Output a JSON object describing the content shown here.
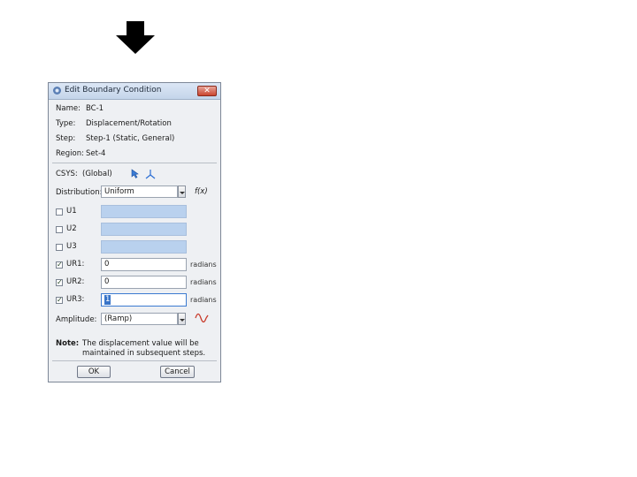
{
  "dialog": {
    "title": "Edit Boundary Condition",
    "close_glyph": "✕",
    "name_label": "Name:",
    "name_value": "BC-1",
    "type_label": "Type:",
    "type_value": "Displacement/Rotation",
    "step_label": "Step:",
    "step_value": "Step-1 (Static, General)",
    "region_label": "Region:",
    "region_value": "Set-4",
    "csys_label": "CSYS:",
    "csys_value": "(Global)",
    "distribution_label": "Distribution:",
    "distribution_value": "Uniform",
    "fx_label": "f(x)",
    "rows": [
      {
        "label": "U1",
        "checked": false,
        "value": "",
        "unit": ""
      },
      {
        "label": "U2",
        "checked": false,
        "value": "",
        "unit": ""
      },
      {
        "label": "U3",
        "checked": false,
        "value": "",
        "unit": ""
      },
      {
        "label": "UR1:",
        "checked": true,
        "value": "0",
        "unit": "radians"
      },
      {
        "label": "UR2:",
        "checked": true,
        "value": "0",
        "unit": "radians"
      },
      {
        "label": "UR3:",
        "checked": true,
        "value": "1",
        "unit": "radians"
      }
    ],
    "amplitude_label": "Amplitude:",
    "amplitude_value": "(Ramp)",
    "note_label": "Note:",
    "note_line1": "The displacement value will be",
    "note_line2": "maintained in subsequent steps.",
    "ok_label": "OK",
    "cancel_label": "Cancel"
  },
  "colors": {
    "arrow": "#000000",
    "disabled_field": "#b9d1ee",
    "title_bar": "#c4d5ea",
    "close_button": "#c9452f"
  },
  "icons": [
    "down-arrow-icon",
    "app-icon",
    "close-icon",
    "select-arrow-icon",
    "csys-axes-icon",
    "amplitude-wave-icon"
  ]
}
